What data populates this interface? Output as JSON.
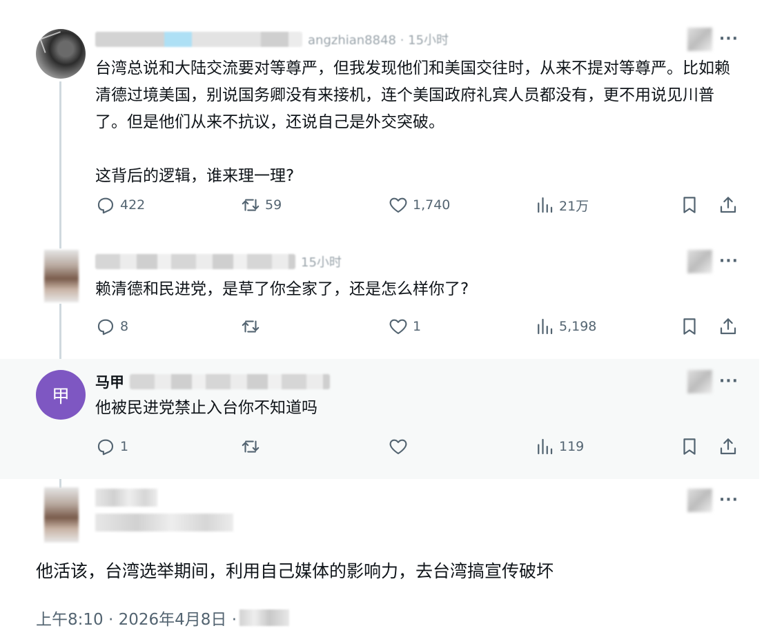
{
  "tweets": [
    {
      "handle_fragment": "angzhian8848 · 15小时",
      "text": "台湾总说和大陆交流要对等尊严，但我发现他们和美国交往时，从来不提对等尊严。比如赖清德过境美国，别说国务卿没有来接机，连个美国政府礼宾人员都没有，更不用说见川普了。但是他们从来不抗议，还说自己是外交突破。\n\n这背后的逻辑，谁来理一理?",
      "replies": "422",
      "retweets": "59",
      "likes": "1,740",
      "views": "21万"
    },
    {
      "handle_fragment": "15小时",
      "text": "赖清德和民进党，是草了你全家了，还是怎么样你了?",
      "replies": "8",
      "retweets": "",
      "likes": "1",
      "views": "5,198"
    },
    {
      "display_name": "马甲",
      "avatar_letter": "甲",
      "avatar_color": "#7e57c2",
      "text": "他被民进党禁止入台你不知道吗",
      "replies": "1",
      "retweets": "",
      "likes": "",
      "views": "119"
    }
  ],
  "main_post": {
    "text": "他活该，台湾选举期间，利用自己媒体的影响力，去台湾搞宣传破坏",
    "timestamp": "上午8:10 · 2026年4月8日 ·"
  },
  "colors": {
    "text": "#0f1419",
    "secondary": "#536471",
    "thread_line": "#cfd9de",
    "shaded_bg": "#f7f9f9"
  },
  "icons": {
    "reply": "reply-icon",
    "retweet": "retweet-icon",
    "like": "heart-icon",
    "views": "views-icon",
    "bookmark": "bookmark-icon",
    "share": "share-icon",
    "more": "more-icon"
  }
}
